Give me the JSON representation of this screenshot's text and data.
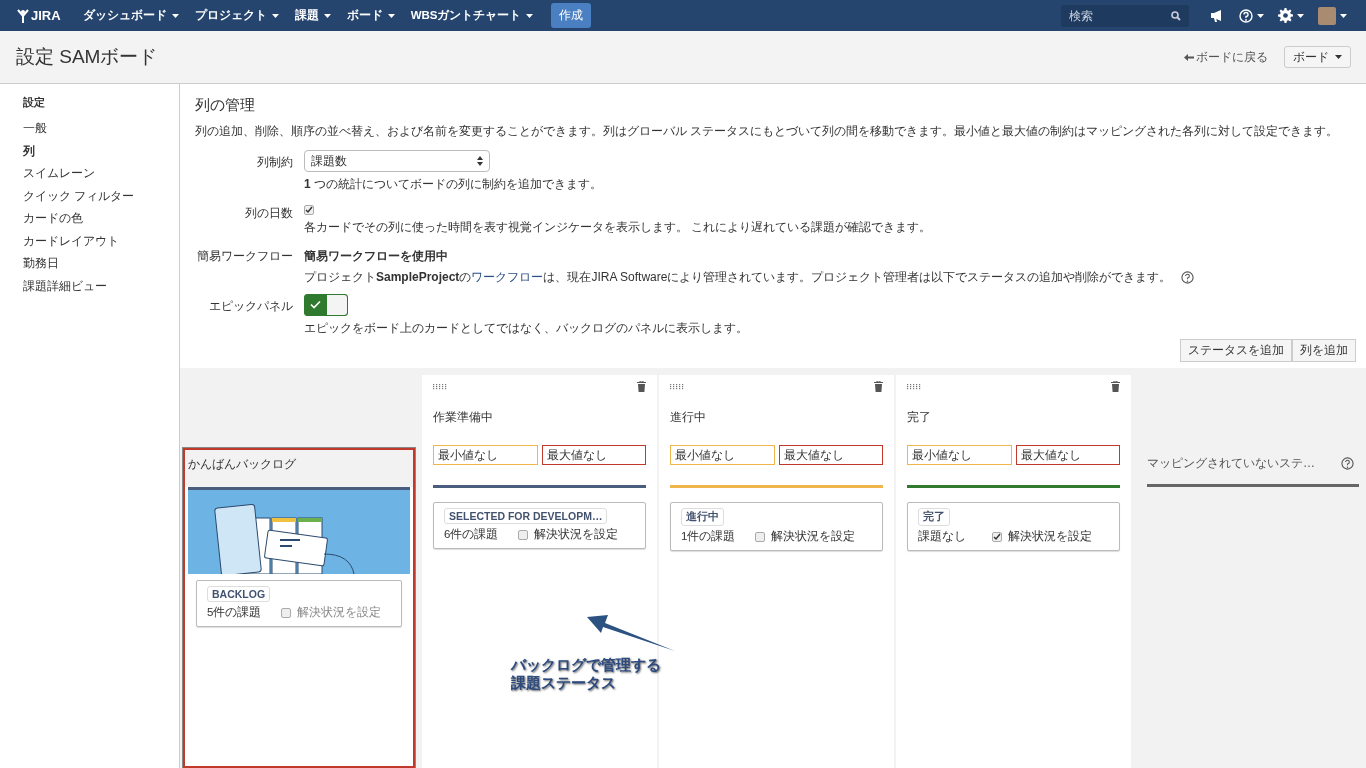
{
  "nav": {
    "logo": "JIRA",
    "menus": [
      {
        "label": "ダッシュボード"
      },
      {
        "label": "プロジェクト"
      },
      {
        "label": "課題"
      },
      {
        "label": "ボード"
      },
      {
        "label": "WBSガントチャート"
      }
    ],
    "create": "作成",
    "search": {
      "placeholder": "検索"
    }
  },
  "header": {
    "title": "設定 SAMボード",
    "back_link": "ボードに戻る",
    "board_menu": "ボード"
  },
  "sidebar": {
    "heading": "設定",
    "items": [
      {
        "label": "一般",
        "selected": false
      },
      {
        "label": "列",
        "selected": true
      },
      {
        "label": "スイムレーン",
        "selected": false
      },
      {
        "label": "クイック フィルター",
        "selected": false
      },
      {
        "label": "カードの色",
        "selected": false
      },
      {
        "label": "カードレイアウト",
        "selected": false
      },
      {
        "label": "勤務日",
        "selected": false
      },
      {
        "label": "課題詳細ビュー",
        "selected": false
      }
    ]
  },
  "section": {
    "title": "列の管理",
    "description": "列の追加、削除、順序の並べ替え、および名前を変更することができます。列はグローバル ステータスにもとづいて列の間を移動できます。最小値と最大値の制約はマッピングされた各列に対して設定できます。",
    "fields": [
      {
        "kind": "select",
        "label": "列制約",
        "value": "課題数",
        "hint": "**1** つの統計についてボードの列に制約を追加できます。"
      },
      {
        "kind": "checkbox",
        "label": "列の日数",
        "checked": true,
        "hint": "各カードでその列に使った時間を表す視覚インジケータを表示します。 これにより遅れている課題が確認できます。"
      },
      {
        "kind": "workflow",
        "label": "簡易ワークフロー",
        "value": "簡易ワークフローを使用中",
        "hint_before": "プロジェクト**SampleProject**の",
        "hint_link": "ワークフロー",
        "hint_after": "は、現在JIRA Softwareにより管理されています。プロジェクト管理者は以下でステータスの追加や削除ができます。"
      },
      {
        "kind": "toggle",
        "label": "エピックパネル",
        "on": true,
        "hint": "エピックをボード上のカードとしてではなく、バックログのパネルに表示します。"
      }
    ]
  },
  "actions": [
    "ステータスを追加",
    "列を追加"
  ],
  "board": {
    "backlog": {
      "title": "かんばんバックログ",
      "color": "#4a5d7e",
      "status": {
        "label": "BACKLOG",
        "count": "5件の課題",
        "resolution": "解決状況を設定",
        "checked": false,
        "disabled": true
      }
    },
    "columns": [
      {
        "title": "作業準備中",
        "min_placeholder": "最小値なし",
        "max_placeholder": "最大値なし",
        "color": "#4a5d7e",
        "status": {
          "label": "SELECTED FOR DEVELOPM…",
          "count": "6件の課題",
          "resolution": "解決状況を設定",
          "checked": false,
          "disabled": false
        }
      },
      {
        "title": "進行中",
        "min_placeholder": "最小値なし",
        "max_placeholder": "最大値なし",
        "color": "#f0b64b",
        "status": {
          "label": "進行中",
          "count": "1件の課題",
          "resolution": "解決状況を設定",
          "checked": false,
          "disabled": false
        }
      },
      {
        "title": "完了",
        "min_placeholder": "最小値なし",
        "max_placeholder": "最大値なし",
        "color": "#2f7a2f",
        "status": {
          "label": "完了",
          "count": "課題なし",
          "resolution": "解決状況を設定",
          "checked": true,
          "disabled": false
        }
      }
    ],
    "unmapped": {
      "title": "マッピングされていないステ…"
    }
  },
  "annotation": {
    "lines": [
      "バックログで管理する",
      "課題ステータス"
    ]
  }
}
